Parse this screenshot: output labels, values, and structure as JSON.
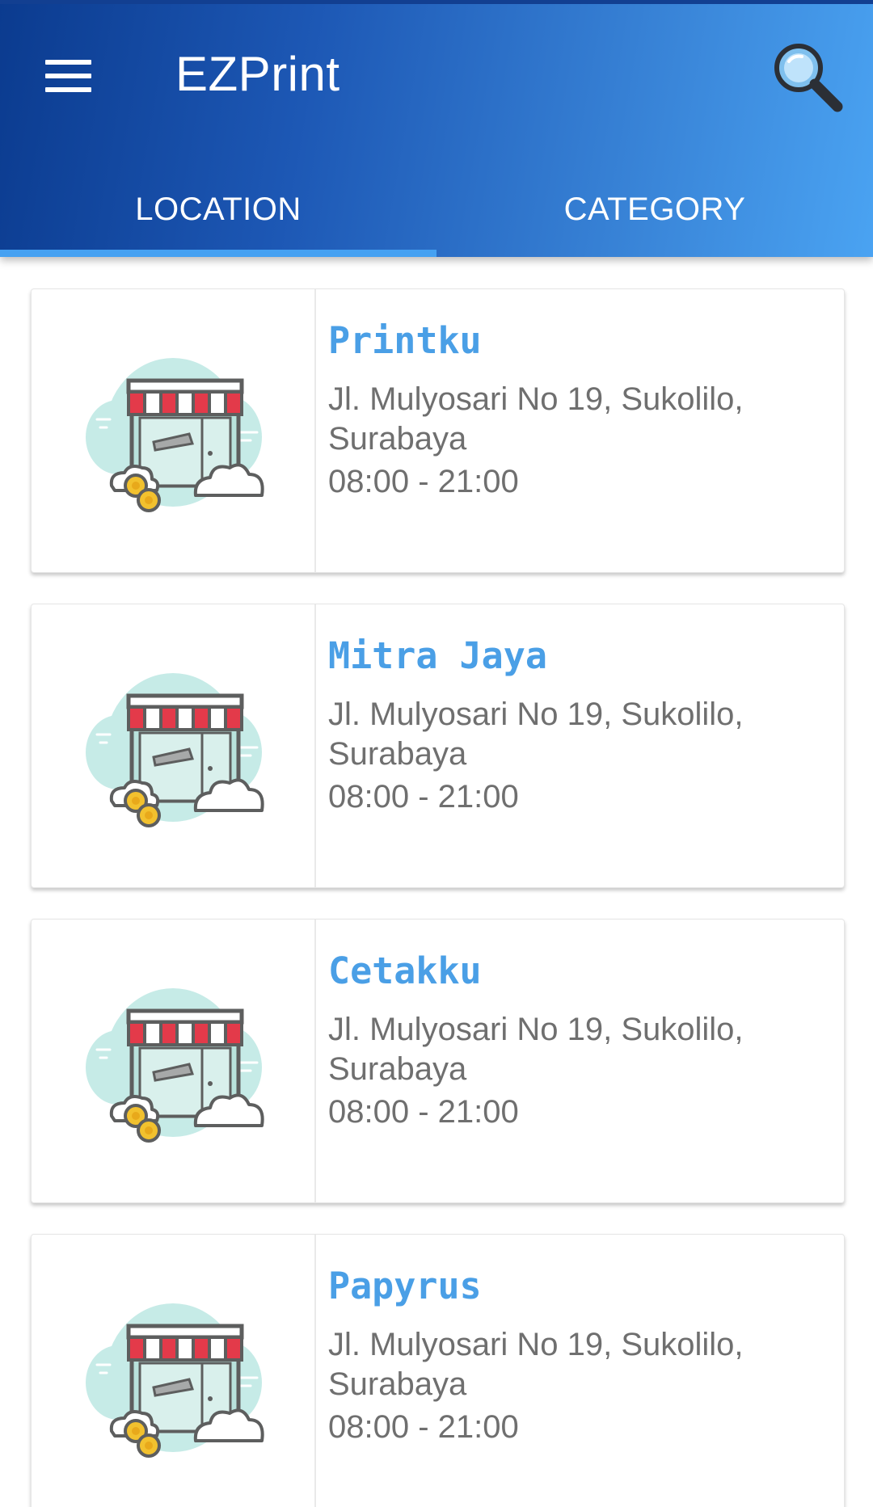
{
  "app": {
    "title": "EZPrint",
    "menu_icon": "hamburger-menu-icon",
    "search_icon": "search-icon"
  },
  "tabs": [
    {
      "label": "LOCATION",
      "selected": true
    },
    {
      "label": "CATEGORY",
      "selected": false
    }
  ],
  "colors": {
    "appbar_start": "#0b3b8f",
    "appbar_end": "#4aa3f2",
    "tab_indicator": "#45a1f2",
    "shop_name": "#4a9fe6",
    "detail_text": "#6f6f6f"
  },
  "shops": [
    {
      "name": "Printku",
      "address": "Jl. Mulyosari No 19, Sukolilo, Surabaya",
      "hours": "08:00 - 21:00",
      "image_icon": "shop-storefront-icon"
    },
    {
      "name": "Mitra Jaya",
      "address": "Jl. Mulyosari No 19, Sukolilo, Surabaya",
      "hours": "08:00 - 21:00",
      "image_icon": "shop-storefront-icon"
    },
    {
      "name": "Cetakku",
      "address": "Jl. Mulyosari No 19, Sukolilo, Surabaya",
      "hours": "08:00 - 21:00",
      "image_icon": "shop-storefront-icon"
    },
    {
      "name": "Papyrus",
      "address": "Jl. Mulyosari No 19, Sukolilo, Surabaya",
      "hours": "08:00 - 21:00",
      "image_icon": "shop-storefront-icon"
    }
  ]
}
